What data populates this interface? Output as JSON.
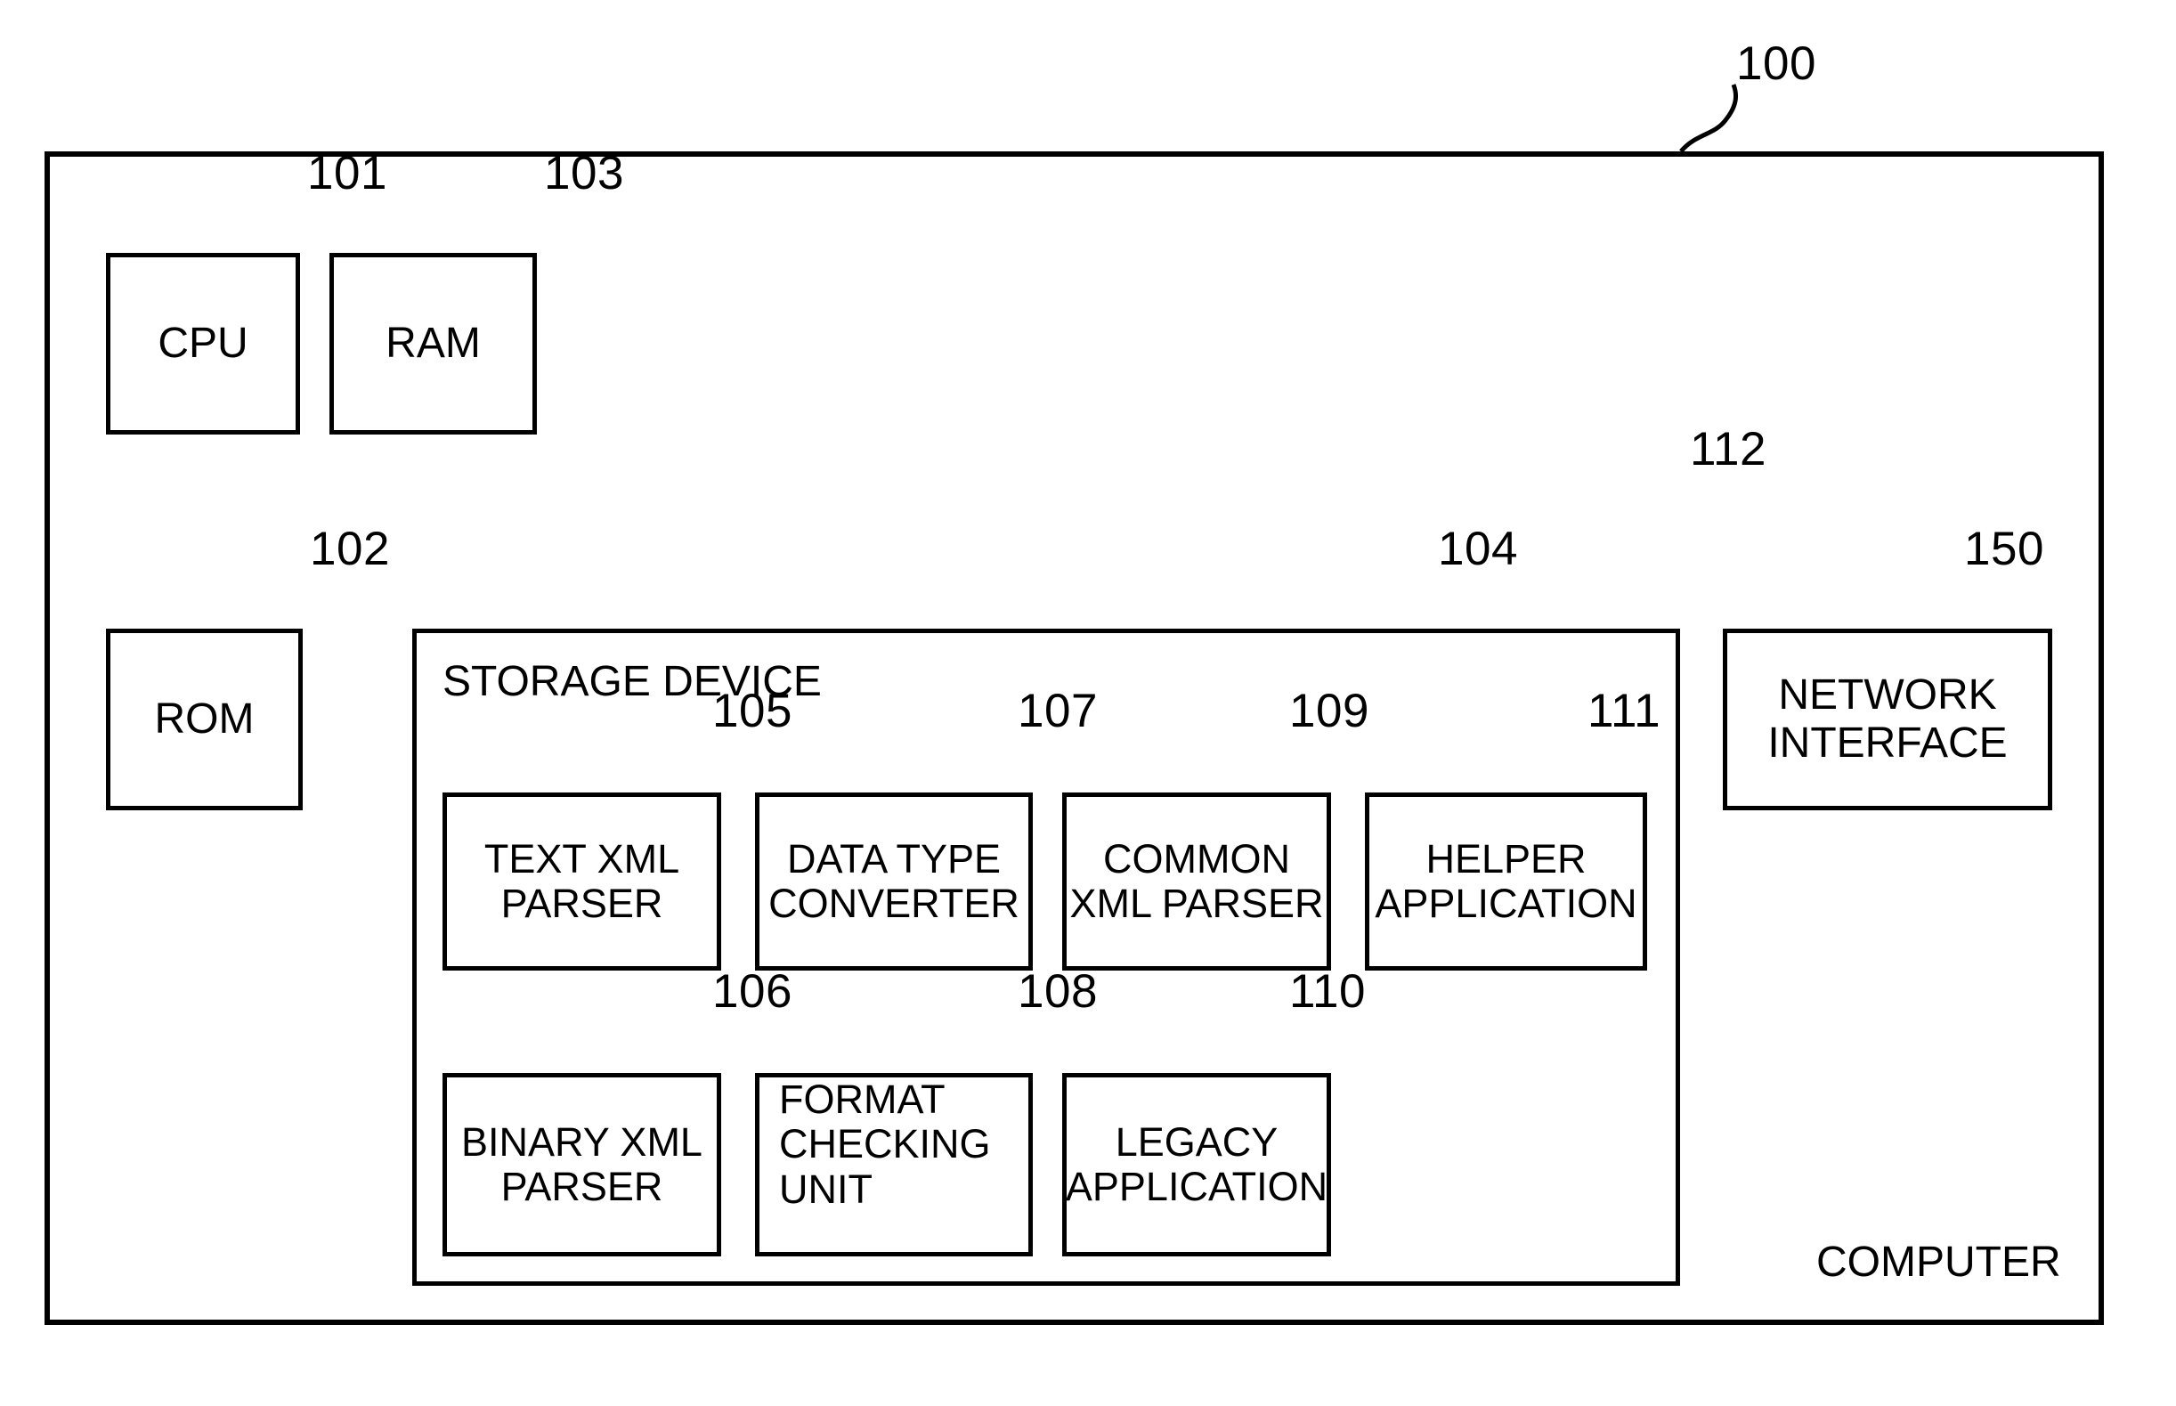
{
  "diagram": {
    "type": "patent-block-diagram",
    "outer": {
      "label": "COMPUTER",
      "ref": "100"
    },
    "bus": {
      "ref": "112"
    },
    "components": [
      {
        "id": "cpu",
        "label": "CPU",
        "ref": "101"
      },
      {
        "id": "ram",
        "label": "RAM",
        "ref": "103"
      },
      {
        "id": "rom",
        "label": "ROM",
        "ref": "102"
      },
      {
        "id": "network-interface",
        "label": "NETWORK\nINTERFACE",
        "line1": "NETWORK",
        "line2": "INTERFACE",
        "ref": "150"
      }
    ],
    "storage": {
      "label": "STORAGE DEVICE",
      "ref": "104",
      "modules_row1": [
        {
          "id": "text-xml-parser",
          "line1": "TEXT XML",
          "line2": "PARSER",
          "line3": "",
          "ref": "105",
          "align": "center"
        },
        {
          "id": "data-type-converter",
          "line1": "DATA TYPE",
          "line2": "CONVERTER",
          "line3": "",
          "ref": "107",
          "align": "center"
        },
        {
          "id": "common-xml-parser",
          "line1": "COMMON",
          "line2": "XML PARSER",
          "line3": "",
          "ref": "109",
          "align": "center"
        },
        {
          "id": "helper-application",
          "line1": "HELPER",
          "line2": "APPLICATION",
          "line3": "",
          "ref": "111",
          "align": "center"
        }
      ],
      "modules_row2": [
        {
          "id": "binary-xml-parser",
          "line1": "BINARY XML",
          "line2": "PARSER",
          "line3": "",
          "ref": "106",
          "align": "center"
        },
        {
          "id": "format-checking-unit",
          "line1": "FORMAT",
          "line2": "CHECKING",
          "line3": "UNIT",
          "ref": "108",
          "align": "left"
        },
        {
          "id": "legacy-application",
          "line1": "LEGACY",
          "line2": "APPLICATION",
          "line3": "",
          "ref": "110",
          "align": "center"
        }
      ]
    }
  }
}
